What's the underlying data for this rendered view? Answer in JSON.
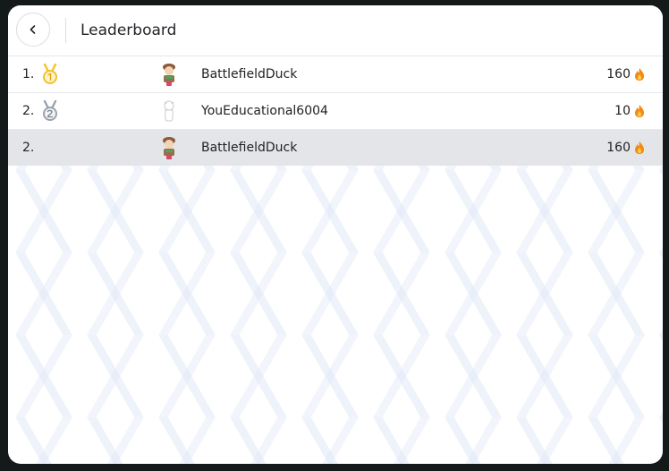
{
  "header": {
    "title": "Leaderboard"
  },
  "rows": [
    {
      "rank": "1.",
      "medal": "gold-medal-icon",
      "avatar": "character-avatar",
      "username": "BattlefieldDuck",
      "score": "160",
      "score_icon": "flame-icon"
    },
    {
      "rank": "2.",
      "medal": "silver-medal-icon",
      "avatar": "character-avatar",
      "username": "YouEducational6004",
      "score": "10",
      "score_icon": "flame-icon"
    }
  ],
  "current_user": {
    "rank": "2.",
    "avatar": "character-avatar",
    "username": "BattlefieldDuck",
    "score": "160",
    "score_icon": "flame-icon"
  },
  "colors": {
    "gold": "#f2c12e",
    "silver": "#9aa3ad",
    "flame": "#f28a16",
    "highlight_row": "#e4e5e8"
  }
}
